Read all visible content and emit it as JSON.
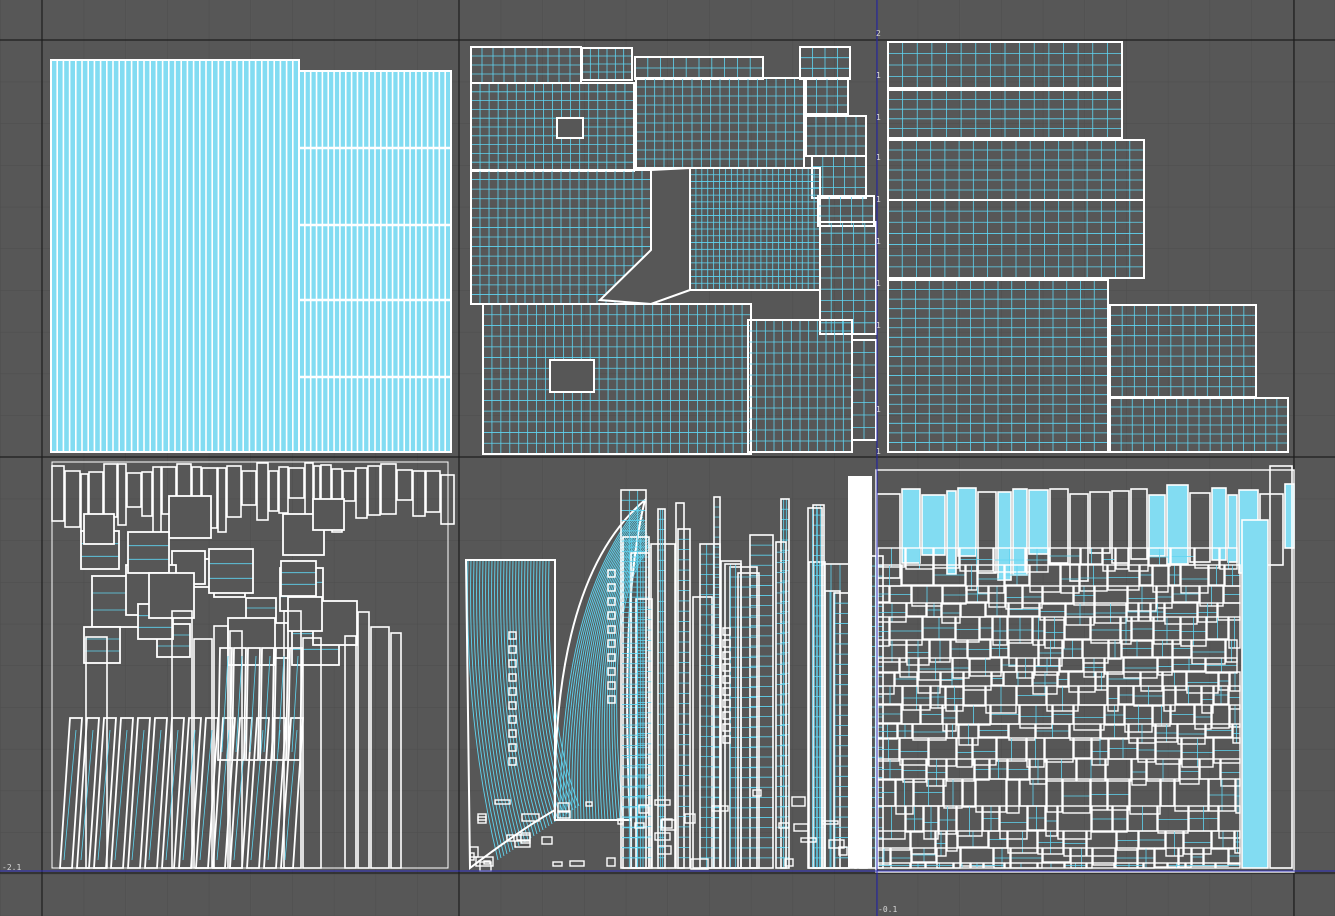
{
  "viewport": {
    "type": "uv-texture-editor",
    "colors": {
      "background": "#575757",
      "grid_minor": "#4e4e4e",
      "grid_major": "#1e1e1e",
      "axis": "#2b2bb8",
      "shell_border": "#ffffff",
      "inner_edges": "#5fd4f0",
      "dense_fill": "#82dcf2"
    },
    "axis_labels": {
      "u_origin": "-2.1",
      "v_bottom": "-0.1",
      "v_top": "2"
    },
    "ticks": [
      "1",
      "1",
      "1",
      "1",
      "1",
      "1",
      "1",
      "1"
    ],
    "tiles": [
      {
        "name": "tile-top-left",
        "content": "vertical-strips"
      },
      {
        "name": "tile-top-center",
        "content": "building-shells"
      },
      {
        "name": "tile-top-right",
        "content": "grid-panels"
      },
      {
        "name": "tile-bottom-left",
        "content": "pillar-shells"
      },
      {
        "name": "tile-bottom-center",
        "content": "skyline-shells"
      },
      {
        "name": "tile-bottom-right",
        "content": "mosaic-blocks"
      }
    ]
  }
}
